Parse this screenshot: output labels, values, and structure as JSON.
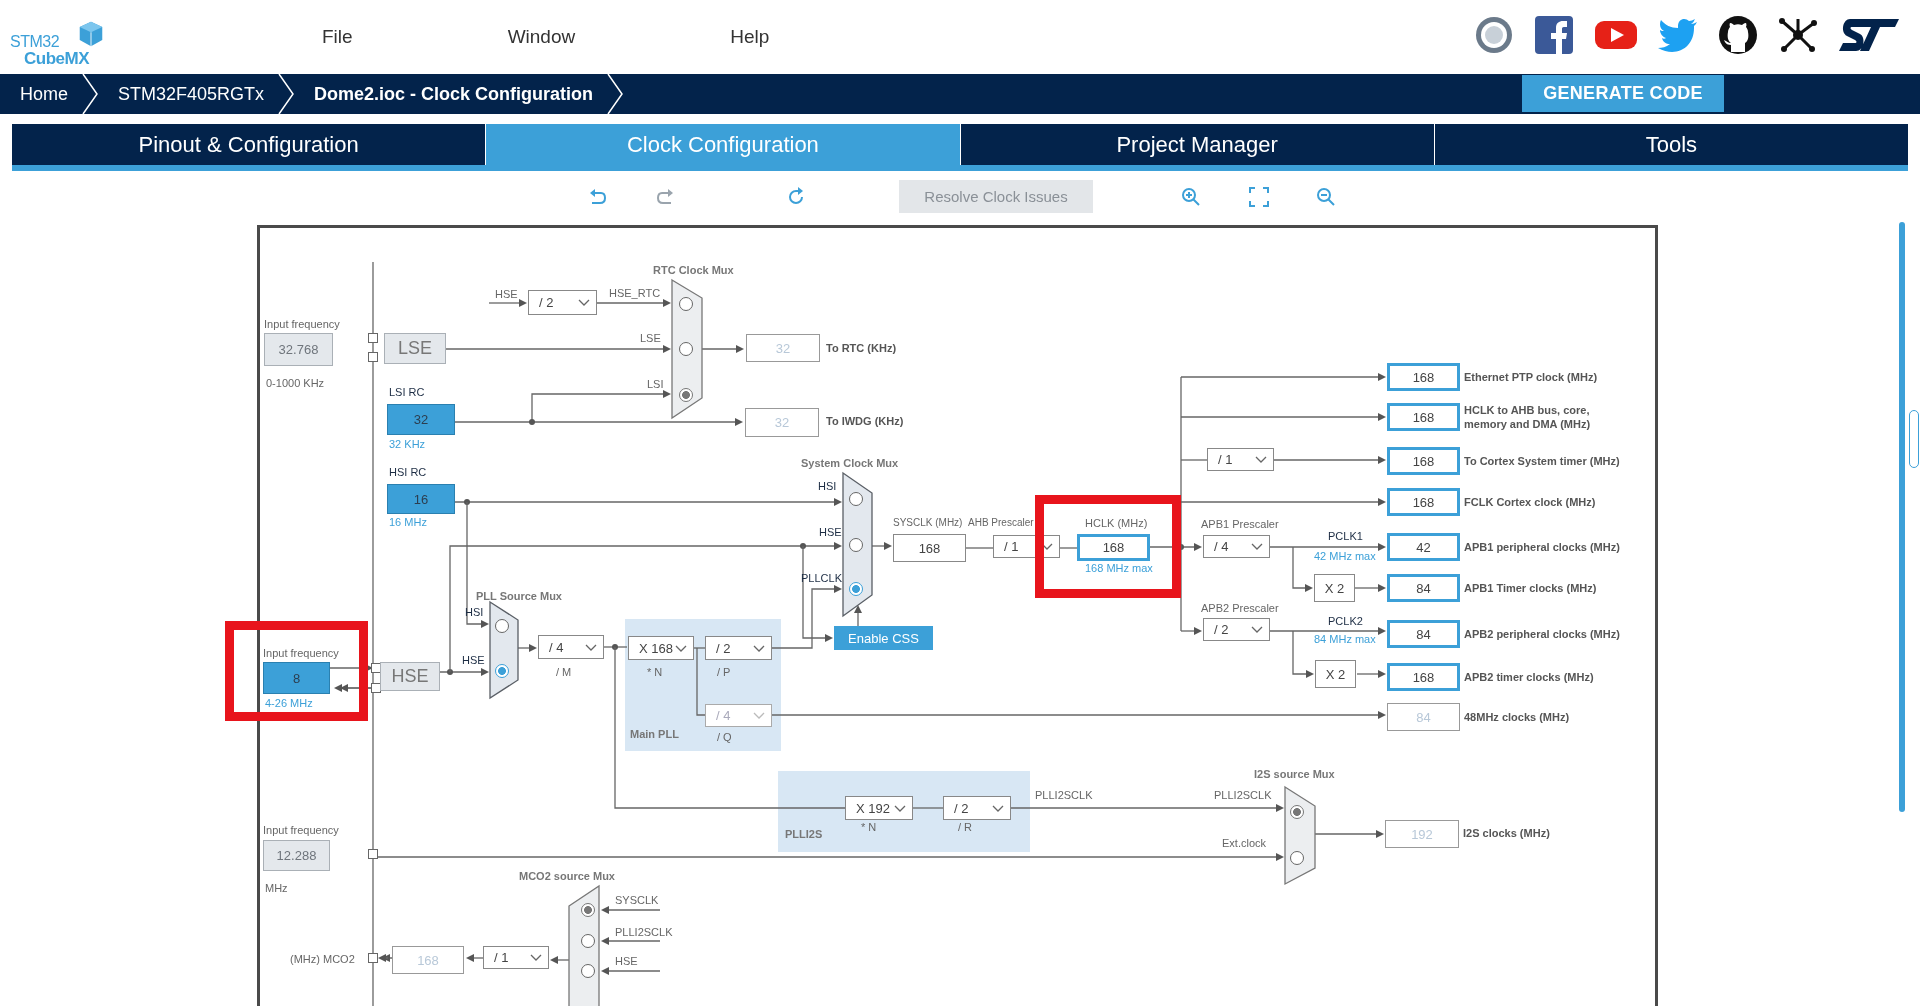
{
  "logo": {
    "line1": "STM32",
    "line2": "CubeMX"
  },
  "menu": [
    "File",
    "Window",
    "Help"
  ],
  "breadcrumb": [
    {
      "label": "Home",
      "current": false
    },
    {
      "label": "STM32F405RGTx",
      "current": false
    },
    {
      "label": "Dome2.ioc - Clock Configuration",
      "current": true
    }
  ],
  "generate_button": "GENERATE CODE",
  "tabs": [
    {
      "label": "Pinout & Configuration",
      "selected": false
    },
    {
      "label": "Clock Configuration",
      "selected": true
    },
    {
      "label": "Project Manager",
      "selected": false
    },
    {
      "label": "Tools",
      "selected": false
    }
  ],
  "toolbar": {
    "resolve_button": {
      "label": "Resolve Clock Issues",
      "disabled": true
    }
  },
  "diagram": {
    "lse": {
      "input_label": "Input frequency",
      "value": "32.768",
      "range": "0-1000 KHz",
      "name": "LSE",
      "enabled": false
    },
    "lsi": {
      "label": "LSI RC",
      "value": "32",
      "note": "32 KHz",
      "enabled": true
    },
    "hsi": {
      "label": "HSI RC",
      "value": "16",
      "note": "16 MHz",
      "enabled": true
    },
    "hse": {
      "input_label": "Input frequency",
      "value": "8",
      "range": "4-26 MHz",
      "name": "HSE",
      "enabled": true
    },
    "ext_i2s": {
      "input_label": "Input frequency",
      "value": "12.288",
      "unit": "MHz",
      "enabled": false
    },
    "rtc_mux": {
      "title": "RTC Clock Mux",
      "active": false,
      "hse_label": "HSE",
      "divider": "/ 2",
      "inputs": [
        {
          "label": "HSE_RTC",
          "selected": false
        },
        {
          "label": "LSE",
          "selected": false
        },
        {
          "label": "LSI",
          "selected": true
        }
      ]
    },
    "rtc_out": {
      "value": "32",
      "label": "To RTC (KHz)",
      "enabled": false
    },
    "iwdg_out": {
      "value": "32",
      "label": "To IWDG (KHz)",
      "enabled": false
    },
    "system_mux": {
      "title": "System Clock Mux",
      "active": true,
      "inputs": [
        {
          "label": "HSI",
          "selected": false
        },
        {
          "label": "HSE",
          "selected": false
        },
        {
          "label": "PLLCLK",
          "selected": true
        }
      ]
    },
    "pll_source_mux": {
      "title": "PLL Source Mux",
      "active": true,
      "inputs": [
        {
          "label": "HSI",
          "selected": false
        },
        {
          "label": "HSE",
          "selected": true
        }
      ]
    },
    "pll_m": {
      "value": "/ 4",
      "label": "/ M"
    },
    "main_pll": {
      "title": "Main PLL",
      "n": {
        "value": "X 168",
        "label": "* N"
      },
      "p": {
        "value": "/ 2",
        "label": "/ P"
      },
      "q": {
        "value": "/ 4",
        "label": "/ Q",
        "disabled": true
      }
    },
    "enable_css": "Enable CSS",
    "sysclk": {
      "label": "SYSCLK (MHz)",
      "value": "168"
    },
    "ahb_prescaler": {
      "label": "AHB Prescaler",
      "value": "/ 1"
    },
    "hclk": {
      "label": "HCLK (MHz)",
      "value": "168",
      "max": "168 MHz max"
    },
    "cortex_divider": "/ 1",
    "apb1": {
      "label": "APB1 Prescaler",
      "value": "/ 4",
      "clock": "PCLK1",
      "max": "42 MHz max",
      "timer_multiplier": "X 2"
    },
    "apb2": {
      "label": "APB2 Prescaler",
      "value": "/ 2",
      "clock": "PCLK2",
      "max": "84 MHz max",
      "timer_multiplier": "X 2"
    },
    "outputs": [
      {
        "value": "168",
        "label": "Ethernet PTP clock (MHz)",
        "enabled": true
      },
      {
        "value": "168",
        "label": "HCLK to AHB bus, core, memory and DMA (MHz)",
        "enabled": true
      },
      {
        "value": "168",
        "label": "To Cortex System timer (MHz)",
        "enabled": true
      },
      {
        "value": "168",
        "label": "FCLK Cortex clock (MHz)",
        "enabled": true
      },
      {
        "value": "42",
        "label": "APB1 peripheral clocks (MHz)",
        "enabled": true
      },
      {
        "value": "84",
        "label": "APB1 Timer clocks (MHz)",
        "enabled": true
      },
      {
        "value": "84",
        "label": "APB2 peripheral clocks (MHz)",
        "enabled": true
      },
      {
        "value": "168",
        "label": "APB2 timer clocks (MHz)",
        "enabled": true
      },
      {
        "value": "84",
        "label": "48MHz clocks (MHz)",
        "enabled": false
      }
    ],
    "plli2s": {
      "title": "PLLI2S",
      "n": {
        "value": "X 192",
        "label": "* N"
      },
      "r": {
        "value": "/ 2",
        "label": "/ R"
      },
      "output_label": "PLLI2SCLK"
    },
    "i2s_mux": {
      "title": "I2S source Mux",
      "active": false,
      "inputs": [
        {
          "label": "PLLI2SCLK",
          "selected": true
        },
        {
          "label": "Ext.clock",
          "selected": false
        }
      ]
    },
    "i2s_out": {
      "value": "192",
      "label": "I2S clocks (MHz)",
      "enabled": false
    },
    "mco2_mux": {
      "title": "MCO2 source Mux",
      "active": false,
      "inputs": [
        {
          "label": "SYSCLK",
          "selected": true
        },
        {
          "label": "PLLI2SCLK",
          "selected": false
        },
        {
          "label": "HSE",
          "selected": false
        }
      ]
    },
    "mco2": {
      "divider": "/ 1",
      "value": "168",
      "label": "(MHz) MCO2"
    }
  }
}
